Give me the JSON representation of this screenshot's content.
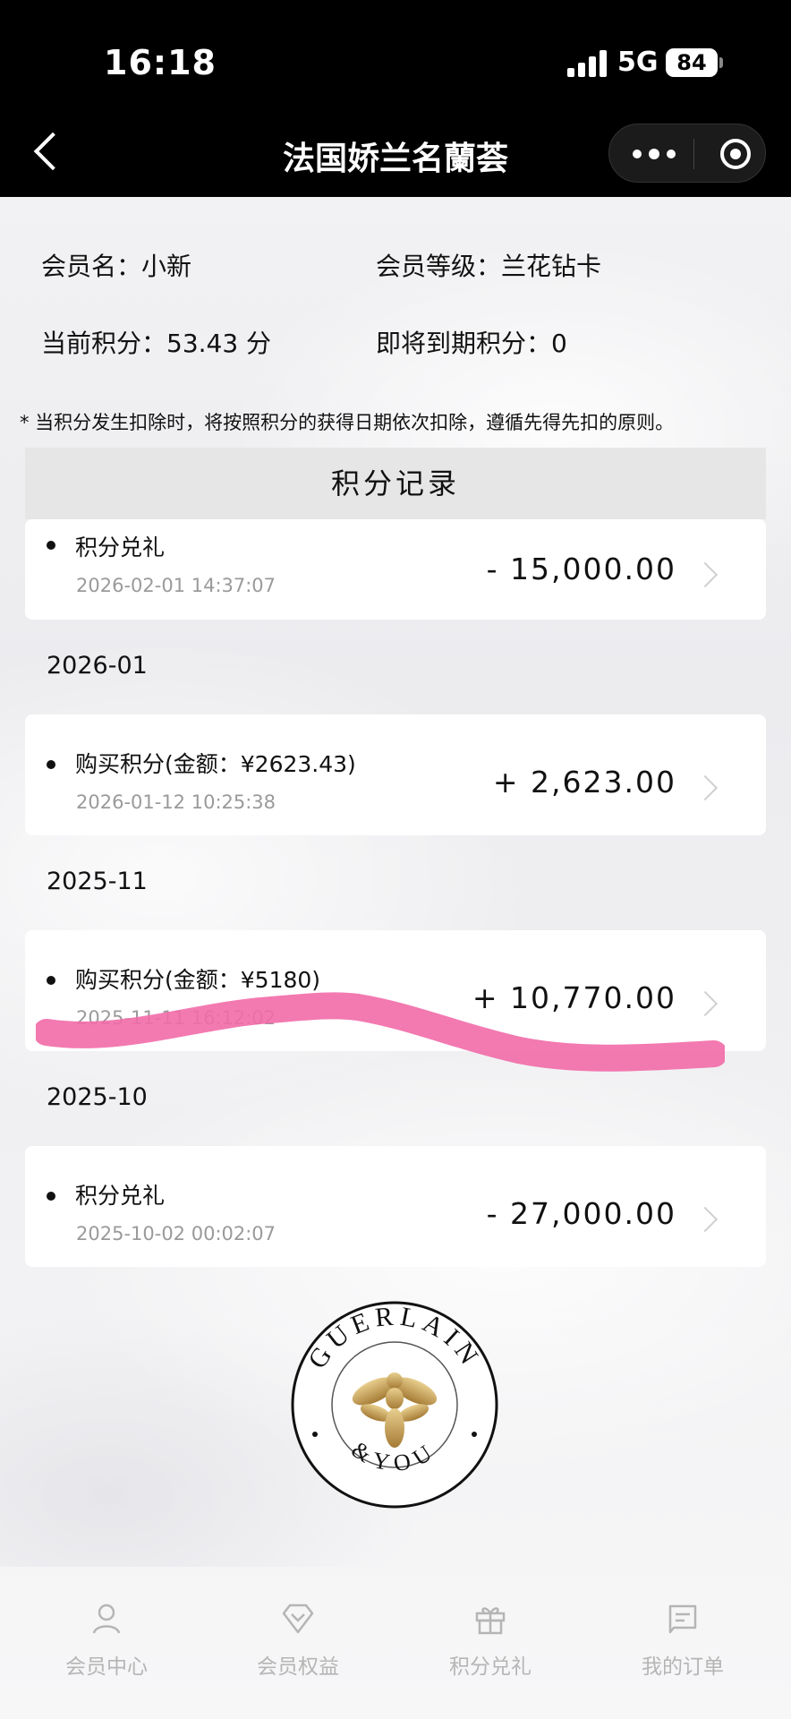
{
  "status_bar": {
    "time": "16:18",
    "network": "5G",
    "battery": "84"
  },
  "nav": {
    "title": "法国娇兰名蘭荟"
  },
  "member": {
    "name_label": "会员名：小新",
    "level_label": "会员等级：兰花钻卡",
    "points_label": "当前积分：53.43 分",
    "expiring_label": "即将到期积分：0"
  },
  "notice": "* 当积分发生扣除时，将按照积分的获得日期依次扣除，遵循先得先扣的原则。",
  "records": {
    "header": "积分记录",
    "items": [
      {
        "title": "积分兑礼",
        "date": "2026-02-01 14:37:07",
        "amount": "- 15,000.00"
      },
      {
        "month": "2026-01",
        "title": "购买积分(金额：¥2623.43)",
        "date": "2026-01-12 10:25:38",
        "amount": "+ 2,623.00"
      },
      {
        "month": "2025-11",
        "title": "购买积分(金额：¥5180)",
        "date": "2025-11-11 16:12:02",
        "amount": "+ 10,770.00"
      },
      {
        "month": "2025-10",
        "title": "积分兑礼",
        "date": "2025-10-02 00:02:07",
        "amount": "- 27,000.00"
      }
    ]
  },
  "logo": {
    "brand": "GUERLAIN",
    "tagline": "&YOU"
  },
  "tabbar": [
    {
      "label": "会员中心",
      "icon": "person-icon"
    },
    {
      "label": "会员权益",
      "icon": "diamond-icon"
    },
    {
      "label": "积分兑礼",
      "icon": "gift-icon"
    },
    {
      "label": "我的订单",
      "icon": "order-icon"
    }
  ],
  "colors": {
    "scribble": "#f26aa8",
    "header_bg": "#e6e6e6",
    "muted": "#9a9a9a"
  }
}
